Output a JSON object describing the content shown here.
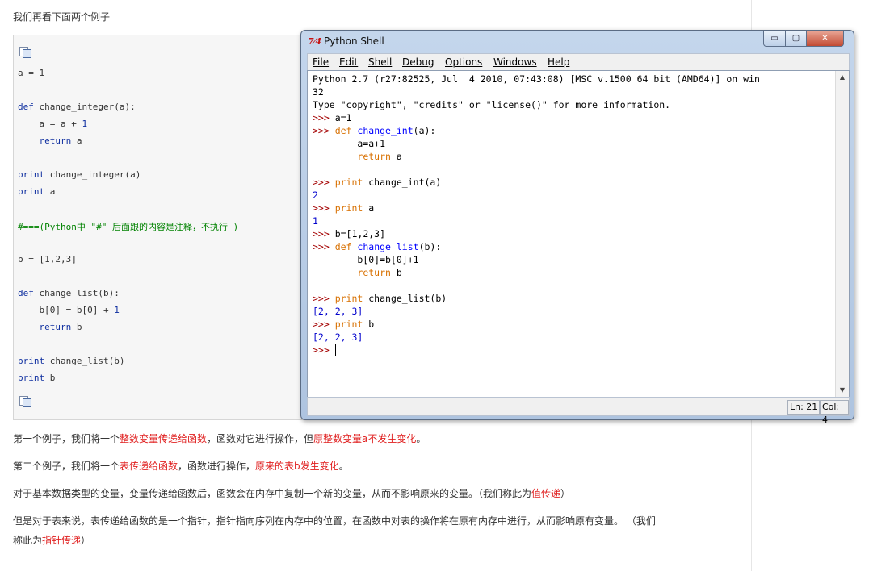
{
  "article": {
    "intro": "我们再看下面两个例子",
    "code_lines": [
      [
        {
          "t": "a = 1",
          "c": ""
        }
      ],
      [],
      [
        {
          "t": "def",
          "c": "kw"
        },
        {
          "t": " change_integer(a):",
          "c": ""
        }
      ],
      [
        {
          "t": "    a = a + ",
          "c": ""
        },
        {
          "t": "1",
          "c": "kw"
        }
      ],
      [
        {
          "t": "    ",
          "c": ""
        },
        {
          "t": "return",
          "c": "kw"
        },
        {
          "t": " a",
          "c": ""
        }
      ],
      [],
      [
        {
          "t": "print",
          "c": "kw"
        },
        {
          "t": " change_integer(a)",
          "c": ""
        }
      ],
      [
        {
          "t": "print",
          "c": "kw"
        },
        {
          "t": " a",
          "c": ""
        }
      ],
      [],
      [
        {
          "t": "#===(Python中 \"#\" 后面跟的内容是注释，不执行 )",
          "c": "cm"
        }
      ],
      [],
      [
        {
          "t": "b = [1,2,3]",
          "c": ""
        }
      ],
      [],
      [
        {
          "t": "def",
          "c": "kw"
        },
        {
          "t": " change_list(b):",
          "c": ""
        }
      ],
      [
        {
          "t": "    b[0] = b[0] + ",
          "c": ""
        },
        {
          "t": "1",
          "c": "kw"
        }
      ],
      [
        {
          "t": "    ",
          "c": ""
        },
        {
          "t": "return",
          "c": "kw"
        },
        {
          "t": " b",
          "c": ""
        }
      ],
      [],
      [
        {
          "t": "print",
          "c": "kw"
        },
        {
          "t": " change_list(b)",
          "c": ""
        }
      ],
      [
        {
          "t": "print",
          "c": "kw"
        },
        {
          "t": " b",
          "c": ""
        }
      ]
    ],
    "paragraphs": [
      [
        {
          "t": "第一个例子，我们将一个",
          "c": ""
        },
        {
          "t": "整数变量传递给函数",
          "c": "red"
        },
        {
          "t": "，函数对它进行操作，但",
          "c": ""
        },
        {
          "t": "原整数变量a不发生变化",
          "c": "red"
        },
        {
          "t": "。",
          "c": ""
        }
      ],
      [
        {
          "t": "第二个例子，我们将一个",
          "c": ""
        },
        {
          "t": "表传递给函数",
          "c": "red"
        },
        {
          "t": "，函数进行操作，",
          "c": ""
        },
        {
          "t": "原来的表b发生变化",
          "c": "red"
        },
        {
          "t": "。",
          "c": ""
        }
      ],
      [
        {
          "t": "对于基本数据类型的变量，变量传递给函数后，函数会在内存中复制一个新的变量，从而不影响原来的变量。（我们称此为",
          "c": ""
        },
        {
          "t": "值传递",
          "c": "red"
        },
        {
          "t": "）",
          "c": ""
        }
      ],
      [
        {
          "t": "但是对于表来说，表传递给函数的是一个指针，指针指向序列在内存中的位置，在函数中对表的操作将在原有内存中进行，从而影响原有变量。 （我们",
          "c": ""
        }
      ],
      [
        {
          "t": "称此为",
          "c": ""
        },
        {
          "t": "指针传递",
          "c": "red"
        },
        {
          "t": "）",
          "c": ""
        }
      ]
    ]
  },
  "window": {
    "app_icon": "7⁄4",
    "title": "Python Shell",
    "min_symbol": "▭",
    "max_symbol": "▢",
    "close_symbol": "✕",
    "menu": [
      "File",
      "Edit",
      "Shell",
      "Debug",
      "Options",
      "Windows",
      "Help"
    ],
    "shell_lines": [
      [
        {
          "t": "Python 2.7 (r27:82525, Jul  4 2010, 07:43:08) [MSC v.1500 64 bit (AMD64)] on win",
          "c": ""
        }
      ],
      [
        {
          "t": "32",
          "c": ""
        }
      ],
      [
        {
          "t": "Type \"copyright\", \"credits\" or \"license()\" for more information.",
          "c": ""
        }
      ],
      [
        {
          "t": ">>> ",
          "c": "pr"
        },
        {
          "t": "a=1",
          "c": ""
        }
      ],
      [
        {
          "t": ">>> ",
          "c": "pr"
        },
        {
          "t": "def",
          "c": "ok"
        },
        {
          "t": " ",
          "c": ""
        },
        {
          "t": "change_int",
          "c": "fn"
        },
        {
          "t": "(a):",
          "c": ""
        }
      ],
      [
        {
          "t": "        a=a+1",
          "c": ""
        }
      ],
      [
        {
          "t": "        ",
          "c": ""
        },
        {
          "t": "return",
          "c": "ok"
        },
        {
          "t": " a",
          "c": ""
        }
      ],
      [],
      [
        {
          "t": ">>> ",
          "c": "pr"
        },
        {
          "t": "print",
          "c": "ok"
        },
        {
          "t": " change_int(a)",
          "c": ""
        }
      ],
      [
        {
          "t": "2",
          "c": "out"
        }
      ],
      [
        {
          "t": ">>> ",
          "c": "pr"
        },
        {
          "t": "print",
          "c": "ok"
        },
        {
          "t": " a",
          "c": ""
        }
      ],
      [
        {
          "t": "1",
          "c": "out"
        }
      ],
      [
        {
          "t": ">>> ",
          "c": "pr"
        },
        {
          "t": "b=[1,2,3]",
          "c": ""
        }
      ],
      [
        {
          "t": ">>> ",
          "c": "pr"
        },
        {
          "t": "def",
          "c": "ok"
        },
        {
          "t": " ",
          "c": ""
        },
        {
          "t": "change_list",
          "c": "fn"
        },
        {
          "t": "(b):",
          "c": ""
        }
      ],
      [
        {
          "t": "        b[0]=b[0]+1",
          "c": ""
        }
      ],
      [
        {
          "t": "        ",
          "c": ""
        },
        {
          "t": "return",
          "c": "ok"
        },
        {
          "t": " b",
          "c": ""
        }
      ],
      [],
      [
        {
          "t": ">>> ",
          "c": "pr"
        },
        {
          "t": "print",
          "c": "ok"
        },
        {
          "t": " change_list(b)",
          "c": ""
        }
      ],
      [
        {
          "t": "[2, 2, 3]",
          "c": "out"
        }
      ],
      [
        {
          "t": ">>> ",
          "c": "pr"
        },
        {
          "t": "print",
          "c": "ok"
        },
        {
          "t": " b",
          "c": ""
        }
      ],
      [
        {
          "t": "[2, 2, 3]",
          "c": "out"
        }
      ],
      [
        {
          "t": ">>> ",
          "c": "pr"
        }
      ]
    ],
    "scroll_up": "▲",
    "scroll_down": "▼",
    "status_line": "Ln: 21",
    "status_col": "Col: 4"
  }
}
